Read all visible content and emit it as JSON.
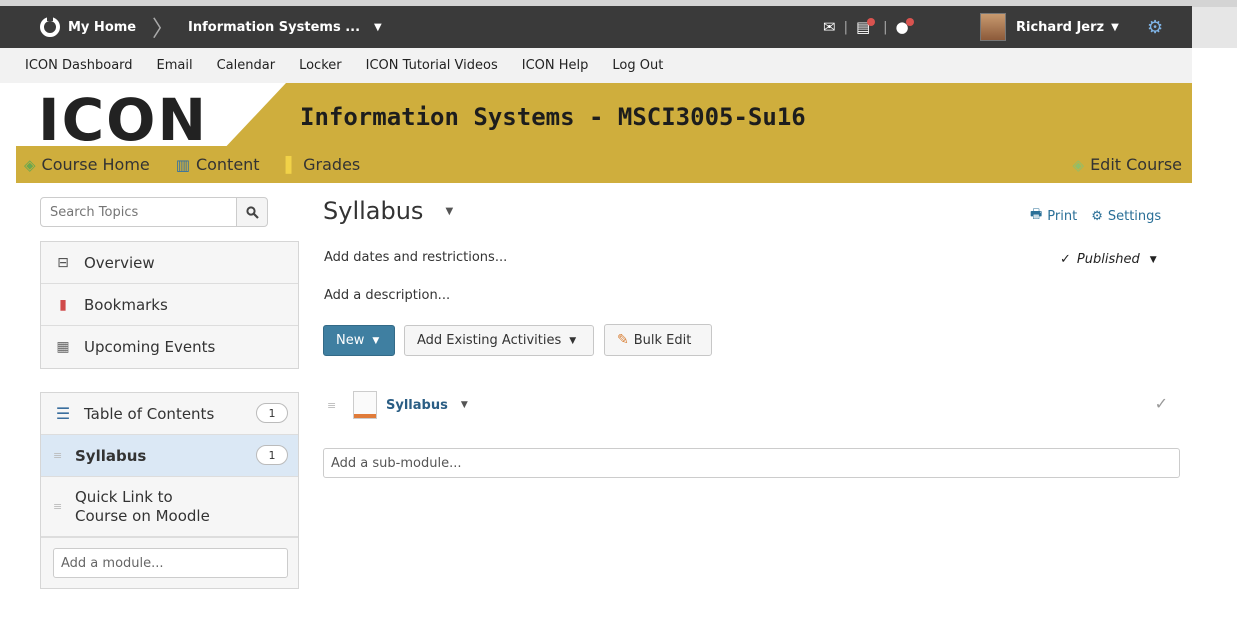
{
  "topbar": {
    "home_label": "My Home",
    "course_label": "Information Systems ...",
    "user_name": "Richard Jerz"
  },
  "linkbar": {
    "links": [
      "ICON Dashboard",
      "Email",
      "Calendar",
      "Locker",
      "ICON Tutorial Videos",
      "ICON Help",
      "Log Out"
    ]
  },
  "banner": {
    "logo_text": "ICON",
    "title": "Information Systems - MSCI3005-Su16",
    "nav": [
      "Course Home",
      "Content",
      "Grades"
    ],
    "edit_course": "Edit Course"
  },
  "sidebar": {
    "search_placeholder": "Search Topics",
    "tools": [
      "Overview",
      "Bookmarks",
      "Upcoming Events"
    ],
    "toc_label": "Table of Contents",
    "toc_count": "1",
    "modules": [
      {
        "label": "Syllabus",
        "count": "1"
      },
      {
        "label": "Quick Link to",
        "label2": "Course on Moodle"
      }
    ],
    "add_module": "Add a module..."
  },
  "main": {
    "title": "Syllabus",
    "print": "Print",
    "settings": "Settings",
    "add_dates": "Add dates and restrictions...",
    "add_description": "Add a description...",
    "status": "Published",
    "buttons": {
      "new": "New",
      "add_existing": "Add Existing Activities",
      "bulk_edit": "Bulk Edit"
    },
    "topic_name": "Syllabus",
    "sub_module_placeholder": "Add a sub-module..."
  },
  "colors": {
    "banner": "#cfae3d",
    "topbar": "#3a3a3a",
    "primary_button": "#3f7fa1",
    "link": "#2a6f97"
  }
}
